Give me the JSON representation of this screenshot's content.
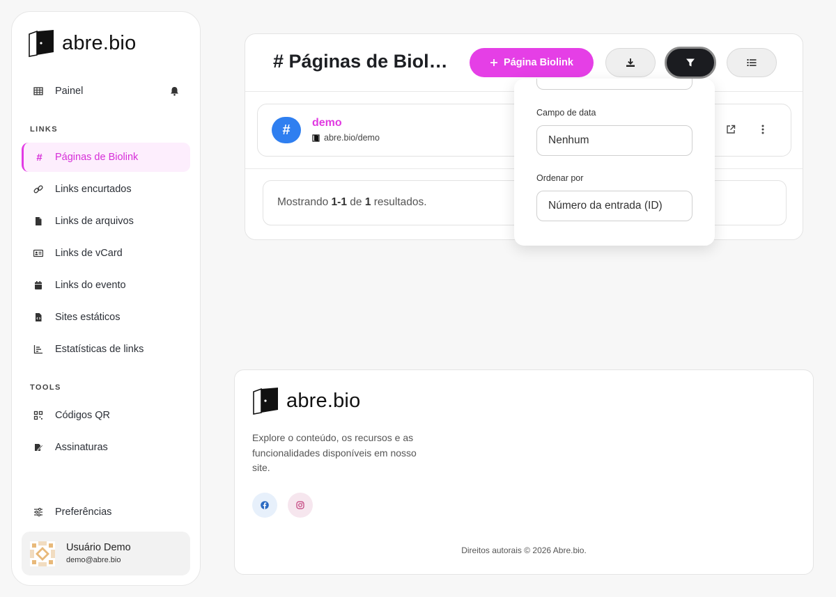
{
  "brand": {
    "name": "abre.bio"
  },
  "sidebar": {
    "dashboard": "Painel",
    "section_links": "LINKS",
    "items": [
      {
        "label": "Páginas de Biolink",
        "icon": "hash-icon"
      },
      {
        "label": "Links encurtados",
        "icon": "link-icon"
      },
      {
        "label": "Links de arquivos",
        "icon": "file-icon"
      },
      {
        "label": "Links de vCard",
        "icon": "vcard-icon"
      },
      {
        "label": "Links do evento",
        "icon": "calendar-icon"
      },
      {
        "label": "Sites estáticos",
        "icon": "file-code-icon"
      },
      {
        "label": "Estatísticas de links",
        "icon": "chart-icon"
      }
    ],
    "section_tools": "TOOLS",
    "tools": [
      {
        "label": "Códigos QR",
        "icon": "qr-icon"
      },
      {
        "label": "Assinaturas",
        "icon": "signature-icon"
      }
    ],
    "preferences": "Preferências",
    "user": {
      "name": "Usuário Demo",
      "email": "demo@abre.bio"
    }
  },
  "main": {
    "title": "Páginas de Biol…",
    "title_hash": "#",
    "add_button": "Página Biolink",
    "row": {
      "badge": "#",
      "title": "demo",
      "url": "abre.bio/demo"
    },
    "results": {
      "prefix": "Mostrando",
      "range": "1-1",
      "of": "de",
      "total": "1",
      "suffix": "resultados."
    }
  },
  "filter_panel": {
    "date_field_label": "Campo de data",
    "date_field_value": "Nenhum",
    "order_label": "Ordenar por",
    "order_value": "Número da entrada (ID)"
  },
  "footer": {
    "description": "Explore o conteúdo, os recursos e as funcionalidades disponíveis em nosso site.",
    "copyright": "Direitos autorais © 2026 Abre.bio."
  },
  "colors": {
    "accent": "#e53fe6",
    "blue": "#2f7ff0",
    "dark": "#1b1c20"
  }
}
